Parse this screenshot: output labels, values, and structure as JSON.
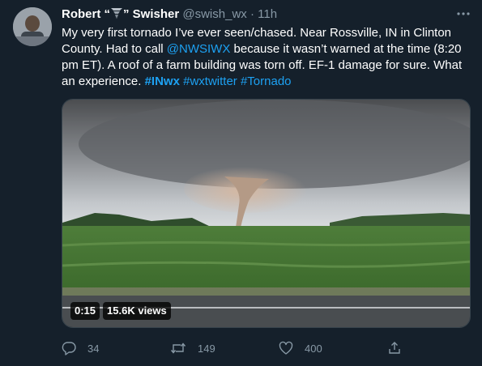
{
  "author": {
    "name_before": "Robert “",
    "name_after": "” Swisher",
    "handle": "@swish_wx",
    "separator": "·",
    "time": "11h"
  },
  "tweet": {
    "text_1": "My very first tornado I’ve ever seen/chased. Near Rossville, IN in Clinton County. Had to call ",
    "mention": "@NWSIWX",
    "text_2": " because it wasn’t warned at the time (8:20 pm ET). A roof of a farm building was torn off. EF-1 damage for sure. What an experience. ",
    "hashtag_1": "#INwx",
    "hashtag_2": "#wxtwitter",
    "hashtag_3": "#Tornado"
  },
  "video": {
    "duration": "0:15",
    "views": "15.6K views"
  },
  "actions": {
    "replies": "34",
    "retweets": "149",
    "likes": "400"
  },
  "colors": {
    "background": "#15202b",
    "secondary_text": "#8899a6",
    "link": "#1da1f2"
  },
  "icons": {
    "more": "more-icon",
    "reply": "reply-icon",
    "retweet": "retweet-icon",
    "like": "like-icon",
    "share": "share-icon",
    "emoji": "tornado-emoji-icon"
  }
}
